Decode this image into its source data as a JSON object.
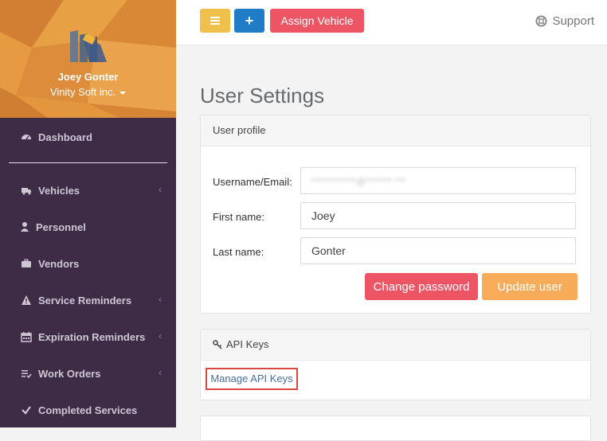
{
  "sidebar": {
    "user_name": "Joey Gonter",
    "company": "Vinity Soft inc.",
    "items": [
      {
        "label": "Dashboard",
        "icon": "dashboard-icon",
        "has_chevron": false
      },
      {
        "label": "Vehicles",
        "icon": "truck-icon",
        "has_chevron": true
      },
      {
        "label": "Personnel",
        "icon": "user-icon",
        "has_chevron": false
      },
      {
        "label": "Vendors",
        "icon": "briefcase-icon",
        "has_chevron": false
      },
      {
        "label": "Service Reminders",
        "icon": "warning-icon",
        "has_chevron": true
      },
      {
        "label": "Expiration Reminders",
        "icon": "calendar-icon",
        "has_chevron": true
      },
      {
        "label": "Work Orders",
        "icon": "checklist-icon",
        "has_chevron": true
      },
      {
        "label": "Completed Services",
        "icon": "checkmark-icon",
        "has_chevron": false
      }
    ],
    "chevron": "‹"
  },
  "topbar": {
    "menu_icon": "hamburger-icon",
    "plus_label": "+",
    "assign_label": "Assign Vehicle",
    "support_label": "Support"
  },
  "main": {
    "title": "User Settings",
    "profile_panel": {
      "heading": "User profile",
      "username_label": "Username/Email:",
      "username_value": "************@*******.***",
      "first_label": "First name:",
      "first_value": "Joey",
      "last_label": "Last name:",
      "last_value": "Gonter",
      "change_password": "Change password",
      "update_user": "Update user"
    },
    "api_panel": {
      "heading": "API Keys",
      "manage_link": "Manage API Keys"
    }
  },
  "colors": {
    "sidebar_bg": "#3e2c47",
    "profile_bg": "#e0913a",
    "yellow_button": "#f0c14a",
    "blue_button": "#1f7cc6",
    "red_button": "#ed5565",
    "orange_button": "#f8ac59",
    "highlight_border": "#d9483f"
  }
}
